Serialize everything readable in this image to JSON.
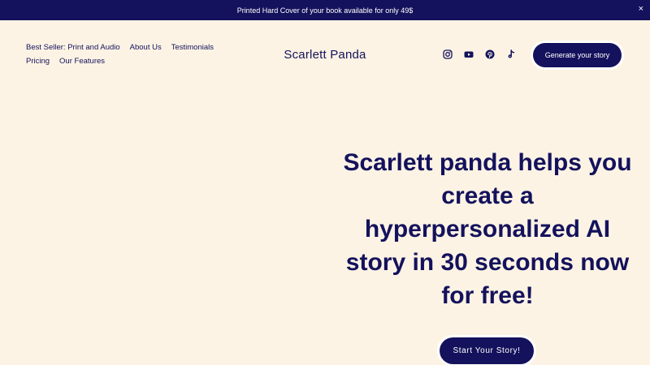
{
  "announcement": {
    "text": "Printed Hard Cover of your book available for only 49$",
    "close_label": "×"
  },
  "nav": {
    "items": [
      {
        "label": "Best Seller: Print and Audio"
      },
      {
        "label": "About Us"
      },
      {
        "label": "Testimonials"
      },
      {
        "label": "Pricing"
      },
      {
        "label": "Our Features"
      }
    ]
  },
  "brand": {
    "name": "Scarlett Panda"
  },
  "social": {
    "icons": [
      "instagram-icon",
      "youtube-icon",
      "pinterest-icon",
      "tiktok-icon"
    ]
  },
  "header": {
    "cta_label": "Generate your story"
  },
  "hero": {
    "headline": "Scarlett panda helps you create a hyperpersonalized AI story in 30 seconds now for free!",
    "cta_label": "Start Your Story!"
  },
  "colors": {
    "background": "#fcf3e4",
    "primary": "#14125c",
    "button_text": "#ffffff"
  }
}
